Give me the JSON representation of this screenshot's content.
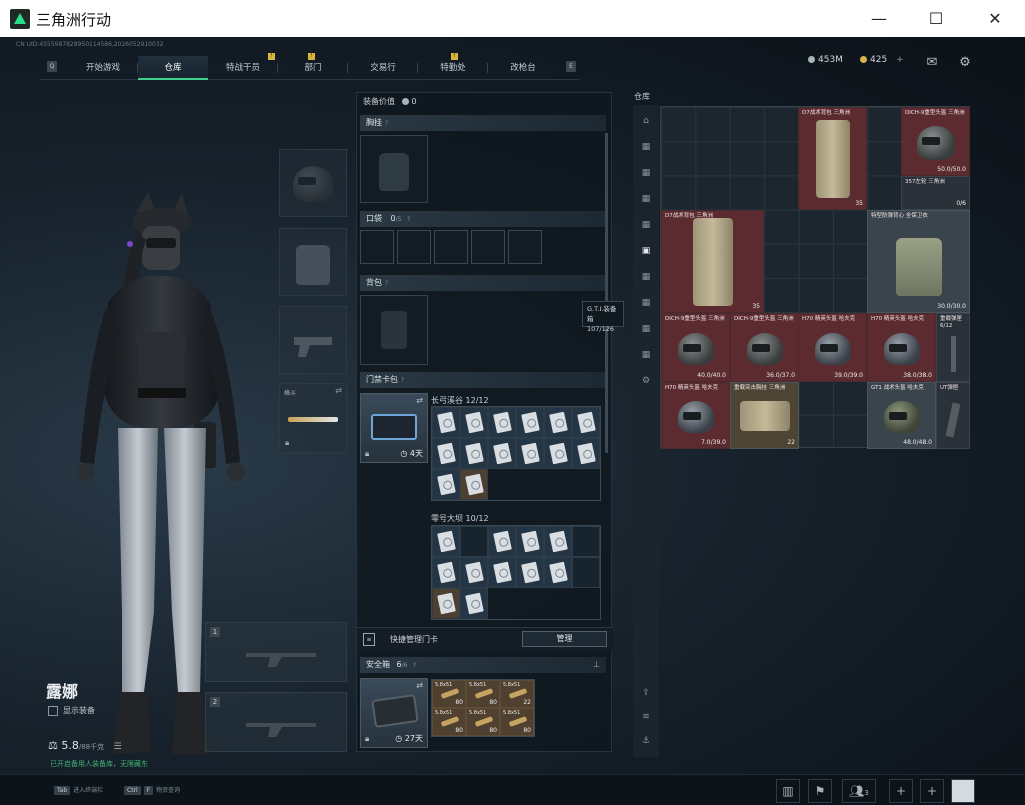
{
  "window": {
    "title": "三角洲行动",
    "minimize": "—",
    "maximize": "☐",
    "close": "✕"
  },
  "uid": "CN UID:4555987828950114586,2026052910032",
  "nav": {
    "key_left": "Q",
    "key_right": "E",
    "tabs": [
      {
        "label": "开始游戏",
        "badge": ""
      },
      {
        "label": "仓库",
        "badge": ""
      },
      {
        "label": "特战干员",
        "badge": "!"
      },
      {
        "label": "部门",
        "badge": ""
      },
      {
        "label": "交易行",
        "badge": "!"
      },
      {
        "label": "特勤处",
        "badge": ""
      },
      {
        "label": "改枪台",
        "badge": "!"
      }
    ]
  },
  "currency": {
    "silver": "453M",
    "gold": "425",
    "gold_plus": "+"
  },
  "character": {
    "name": "露娜",
    "show_equipment": "显示装备",
    "weight": "5.8",
    "weight_max": "/88千克",
    "tip": "已开启备用人装备库，无限藏东",
    "weapon_slot_1": "1",
    "weapon_slot_2": "2",
    "melee_label": "格斗"
  },
  "center": {
    "value_label": "装备价值",
    "value": "0",
    "chest": "胸挂",
    "pocket": "口袋",
    "pocket_count": "0",
    "pocket_unit": "/5",
    "backpack": "背包",
    "keycard": "门禁卡包",
    "keycard_days": "4天",
    "group1_title": "长弓溪谷",
    "group1_count": "12/12",
    "group2_title": "零号大坝",
    "group2_count": "10/12",
    "quick_manage": "快捷管理门卡",
    "manage_btn": "管理",
    "safebox": "安全箱",
    "safebox_count": "6",
    "safebox_unit": "/6",
    "safebox_days": "27天",
    "ammo": [
      {
        "label": "5.8x51",
        "count": "80"
      },
      {
        "label": "5.8x51",
        "count": "80"
      },
      {
        "label": "5.8x51",
        "count": "22"
      },
      {
        "label": "5.8x51",
        "count": "80"
      },
      {
        "label": "5.8x51",
        "count": "80"
      },
      {
        "label": "5.8x51",
        "count": "80"
      }
    ]
  },
  "tooltip": {
    "line1": "G.T.I.装备箱",
    "line2": "107/126"
  },
  "warehouse": {
    "title": "仓库",
    "items": [
      {
        "name": "D7战术背包\n三角洲",
        "dur": "35",
        "kind": "pack",
        "color": "red"
      },
      {
        "name": "DICH-9重型头盔\n三角洲",
        "dur": "50.0/50.0",
        "kind": "helmet",
        "color": "red"
      },
      {
        "name": "357左轮\n三角洲",
        "dur": "0/6",
        "kind": "small",
        "color": "dark"
      },
      {
        "name": "D7战术背包\n三角洲",
        "dur": "35",
        "kind": "pack",
        "color": "red"
      },
      {
        "name": "特型防弹背心\n全保卫衣",
        "dur": "30.0/30.0",
        "kind": "vest",
        "color": "gray"
      },
      {
        "name": "DICH-9重型头盔\n三角洲",
        "dur": "40.0/40.0",
        "kind": "helmet",
        "color": "red"
      },
      {
        "name": "DICH-9重型头盔\n三角洲",
        "dur": "36.0/37.0",
        "kind": "helmet",
        "color": "red"
      },
      {
        "name": "H70 精英头盔\n哈夫克",
        "dur": "39.0/39.0",
        "kind": "helmet",
        "color": "red"
      },
      {
        "name": "H70 精英头盔\n哈夫克",
        "dur": "38.0/38.0",
        "kind": "helmet",
        "color": "red"
      },
      {
        "name": "重载弹匣6/12",
        "dur": "",
        "kind": "small",
        "color": "dark"
      },
      {
        "name": "H70 精英头盔\n哈夫克",
        "dur": "7.0/39.0",
        "kind": "helmet",
        "color": "red"
      },
      {
        "name": "重载突击胸挂\n三角洲",
        "dur": "22",
        "kind": "rig",
        "color": "gray"
      },
      {
        "name": "GT1 战术头盔\n哈夫克",
        "dur": "48.0/48.0",
        "kind": "helmet",
        "color": "gray"
      },
      {
        "name": "UT弹匣",
        "dur": "",
        "kind": "small",
        "color": "dark"
      }
    ]
  },
  "bottom": {
    "hint1_key": "Tab",
    "hint1": "进入终端栏",
    "hint2_key": "Ctrl",
    "hint2_key2": "F",
    "hint2": "物资查询",
    "friends": "3"
  }
}
